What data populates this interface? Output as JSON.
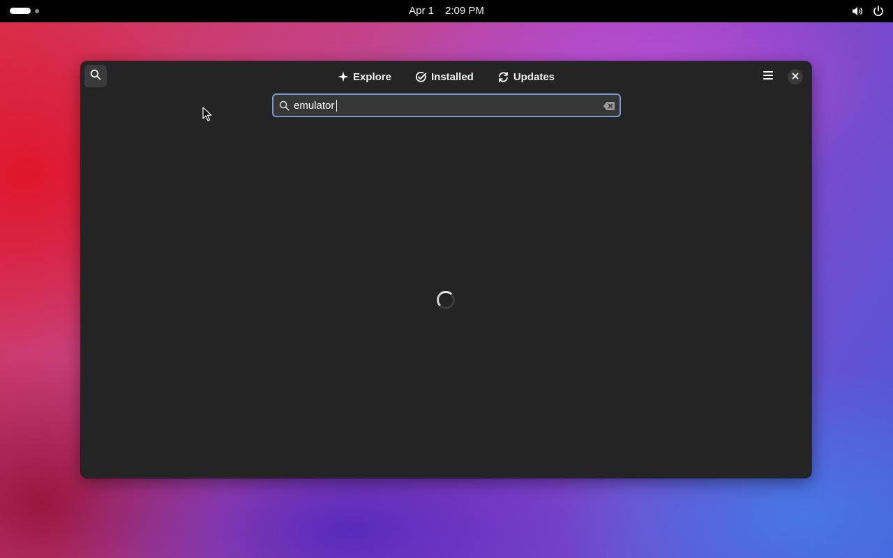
{
  "topbar": {
    "date": "Apr 1",
    "time": "2:09 PM",
    "icons": [
      "workspace-indicator",
      "volume-icon",
      "power-icon"
    ]
  },
  "window": {
    "tabs": [
      {
        "label": "Explore",
        "icon": "explore-sparkle-icon"
      },
      {
        "label": "Installed",
        "icon": "installed-check-icon"
      },
      {
        "label": "Updates",
        "icon": "updates-refresh-icon"
      }
    ],
    "search": {
      "value": "emulator",
      "placeholder": ""
    },
    "header_icons": [
      "search-icon",
      "hamburger-menu-icon",
      "close-icon"
    ],
    "loading": true
  },
  "colors": {
    "window_bg": "#242424",
    "accent_focus": "#7a9ad0",
    "topbar_bg": "#000000"
  }
}
